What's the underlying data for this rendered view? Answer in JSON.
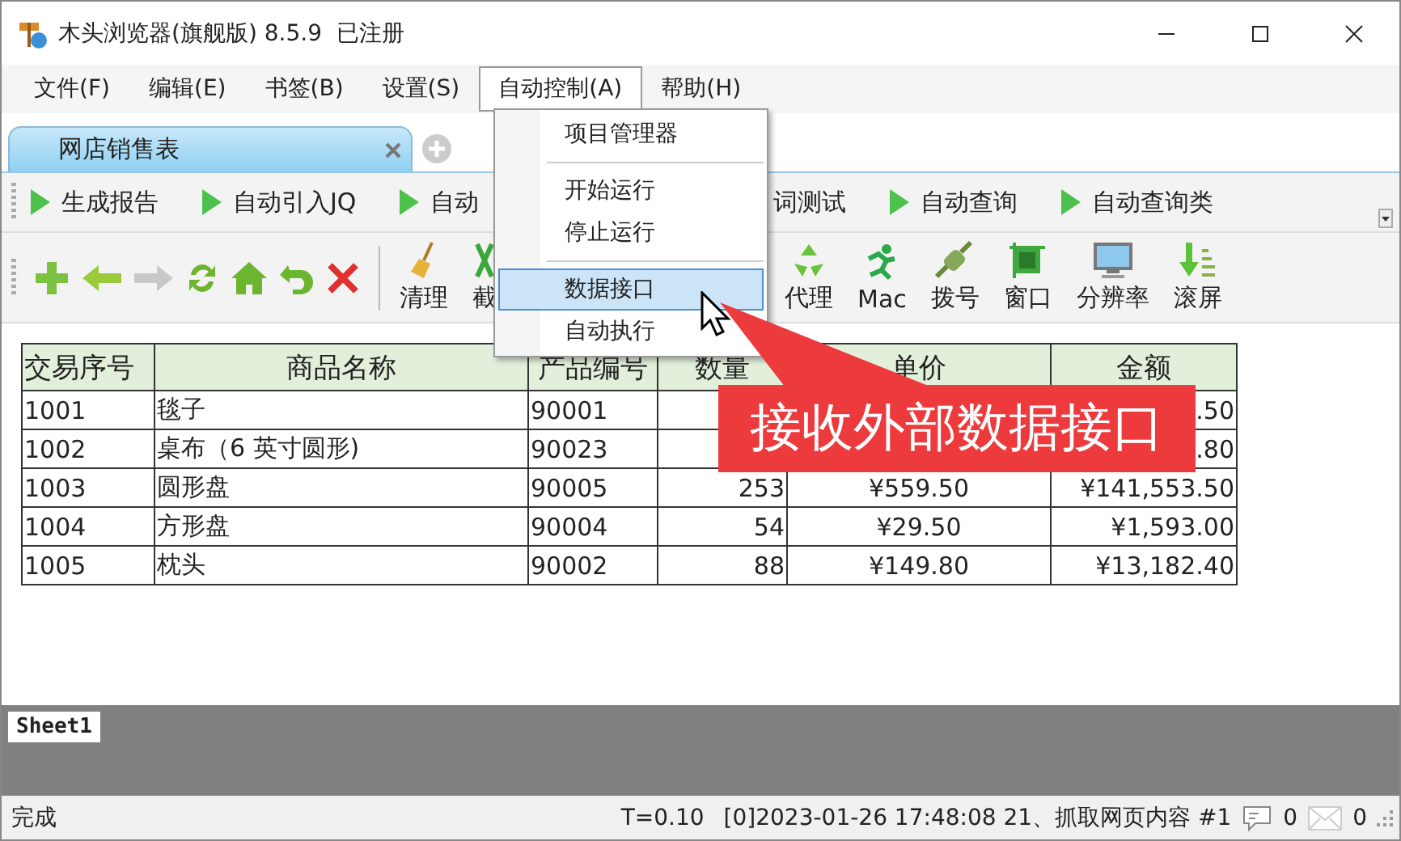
{
  "window": {
    "title": "木头浏览器(旗舰版) 8.5.9  已注册"
  },
  "menu_bar": [
    {
      "label": "文件(F)",
      "selected": false
    },
    {
      "label": "编辑(E)",
      "selected": false
    },
    {
      "label": "书签(B)",
      "selected": false
    },
    {
      "label": "设置(S)",
      "selected": false
    },
    {
      "label": "自动控制(A)",
      "selected": true
    },
    {
      "label": "帮助(H)",
      "selected": false
    }
  ],
  "tabs": [
    {
      "label": "网店销售表",
      "selected": true
    }
  ],
  "toolbar_1": [
    {
      "kind": "play",
      "label": "生成报告"
    },
    {
      "kind": "play",
      "label": "自动引入JQ"
    },
    {
      "kind": "play",
      "label": "自动"
    },
    {
      "kind": "text",
      "label": "词测试"
    },
    {
      "kind": "play",
      "label": "自动查询"
    },
    {
      "kind": "play",
      "label": "自动查询类"
    }
  ],
  "toolbar_2": [
    {
      "label": "清理"
    },
    {
      "label": "截"
    },
    {
      "label": "代理"
    },
    {
      "label": "Mac"
    },
    {
      "label": "拨号"
    },
    {
      "label": "窗口"
    },
    {
      "label": "分辨率"
    },
    {
      "label": "滚屏"
    }
  ],
  "dropdown_menu": [
    {
      "kind": "item",
      "label": "项目管理器",
      "selected": false
    },
    {
      "kind": "separator"
    },
    {
      "kind": "item",
      "label": "开始运行",
      "selected": false
    },
    {
      "kind": "item",
      "label": "停止运行",
      "selected": false
    },
    {
      "kind": "separator"
    },
    {
      "kind": "item",
      "label": "数据接口",
      "selected": true
    },
    {
      "kind": "item",
      "label": "自动执行",
      "selected": false
    }
  ],
  "table": {
    "columns": [
      "交易序号",
      "商品名称",
      "产品编号",
      "数量",
      "单价",
      "金额"
    ],
    "rows": [
      [
        "1001",
        "毯子",
        "90001",
        null,
        null,
        ".50"
      ],
      [
        "1002",
        "桌布（6 英寸圆形)",
        "90023",
        null,
        null,
        ".80"
      ],
      [
        "1003",
        "圆形盘",
        "90005",
        "253",
        "¥559.50",
        "¥141,553.50"
      ],
      [
        "1004",
        "方形盘",
        "90004",
        "54",
        "¥29.50",
        "¥1,593.00"
      ],
      [
        "1005",
        "枕头",
        "90002",
        "88",
        "¥149.80",
        "¥13,182.40"
      ]
    ]
  },
  "callout": {
    "text": "接收外部数据接口"
  },
  "sheet_tabs": [
    {
      "label": "Sheet1",
      "selected": true
    }
  ],
  "status_bar": {
    "status": "完成",
    "timing": "T=0.10",
    "log": "[0]2023-01-26 17:48:08 21、抓取网页内容 #1",
    "message_count": "0",
    "mail_count": "0"
  }
}
